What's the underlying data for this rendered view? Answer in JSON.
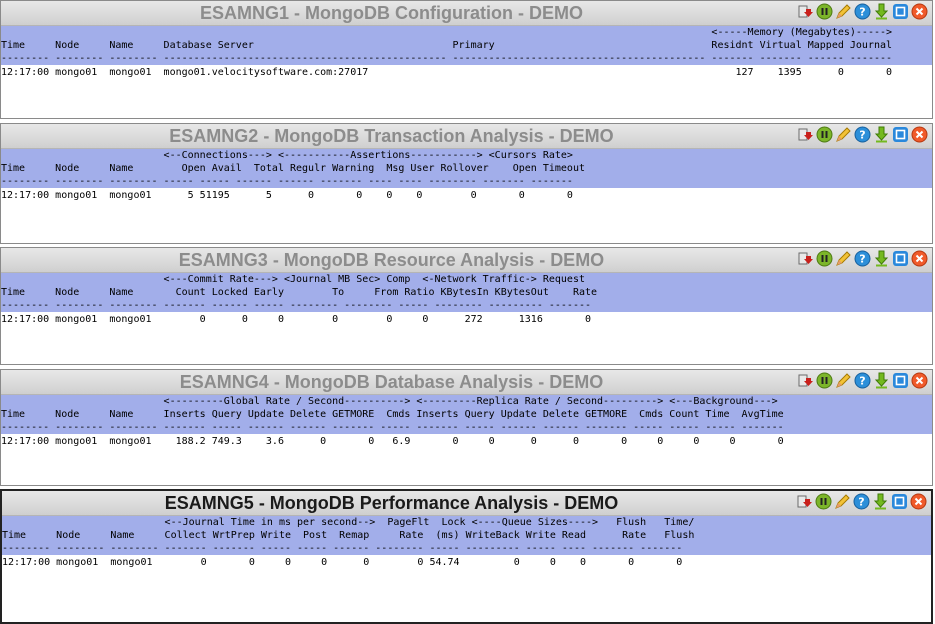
{
  "panels": [
    {
      "title": "ESAMNG1 - MongoDB Configuration - DEMO",
      "header": [
        "                                                                                                                      <-----Memory (Megabytes)----->",
        "Time     Node     Name     Database Server                                 Primary                                    Residnt Virtual Mapped Journal",
        "-------- -------- -------- ----------------------------------------------- ------------------------------------------ ------- ------- ------ -------"
      ],
      "rows": [
        "12:17:00 mongo01  mongo01  mongo01.velocitysoftware.com:27017                                                             127    1395      0       0"
      ]
    },
    {
      "title": "ESAMNG2 - MongoDB Transaction Analysis - DEMO",
      "header": [
        "                           <--Connections---> <-----------Assertions-----------> <Cursors Rate>",
        "Time     Node     Name        Open Avail  Total Regulr Warning  Msg User Rollover    Open Timeout",
        "-------- -------- -------- ----- ----- ------ ------ ------- ---- ---- -------- ------- -------"
      ],
      "rows": [
        "12:17:00 mongo01  mongo01      5 51195      5      0       0    0    0        0       0       0"
      ]
    },
    {
      "title": "ESAMNG3 - MongoDB Resource Analysis - DEMO",
      "header": [
        "                           <---Commit Rate---> <Journal MB Sec> Comp  <-Network Traffic-> Request",
        "Time     Node     Name       Count Locked Early        To     From Ratio KBytesIn KBytesOut    Rate",
        "-------- -------- -------- ------- ------ ----- -------- -------- ----- -------- --------- -------"
      ],
      "rows": [
        "12:17:00 mongo01  mongo01        0      0     0        0        0     0      272      1316       0"
      ]
    },
    {
      "title": "ESAMNG4 - MongoDB Database Analysis - DEMO",
      "header": [
        "                           <---------Global Rate / Second----------> <---------Replica Rate / Second---------> <---Background--->",
        "Time     Node     Name     Inserts Query Update Delete GETMORE  Cmds Inserts Query Update Delete GETMORE  Cmds Count Time  AvgTime",
        "-------- -------- -------- ------- ----- ------ ------ ------- ----- ------- ----- ------ ------ ------- ----- ----- ----- -------"
      ],
      "rows": [
        "12:17:00 mongo01  mongo01    188.2 749.3    3.6      0       0   6.9       0     0      0      0       0     0     0     0       0"
      ]
    },
    {
      "title": "ESAMNG5 - MongoDB Performance Analysis - DEMO",
      "header": [
        "                           <--Journal Time in ms per second-->  PageFlt  Lock <----Queue Sizes---->   Flush   Time/",
        "Time     Node     Name     Collect WrtPrep Write  Post  Remap     Rate  (ms) WriteBack Write Read      Rate   Flush",
        "-------- -------- -------- ------- ------- ----- ----- ------ -------- ----- --------- ----- ---- ------- -------"
      ],
      "rows": [
        "12:17:00 mongo01  mongo01        0       0     0     0      0        0 54.74         0     0    0       0       0"
      ]
    }
  ],
  "toolbar_icons": [
    "export-icon",
    "pause-icon",
    "edit-icon",
    "help-icon",
    "download-icon",
    "maximize-icon",
    "close-icon"
  ],
  "colors": {
    "header_bg": "#a2aeea",
    "title_inactive": "#8c8c8c",
    "title_active": "#1a1a1a"
  }
}
